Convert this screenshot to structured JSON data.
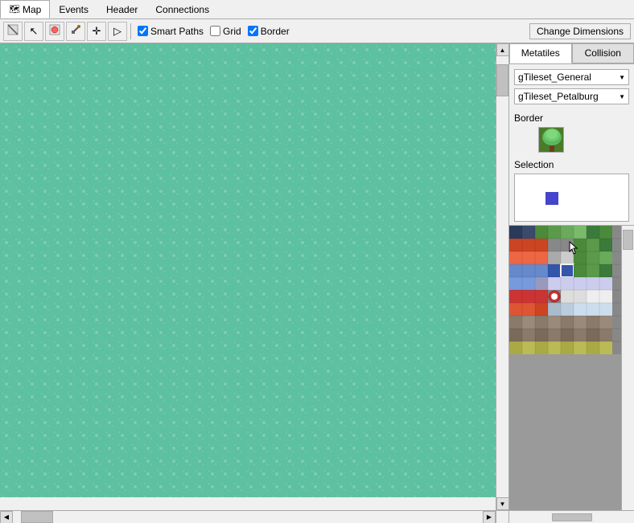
{
  "menu": {
    "tabs": [
      {
        "id": "map",
        "label": "Map",
        "active": true,
        "icon": "🗺"
      },
      {
        "id": "events",
        "label": "Events",
        "active": false
      },
      {
        "id": "header",
        "label": "Header",
        "active": false
      },
      {
        "id": "connections",
        "label": "Connections",
        "active": false
      }
    ]
  },
  "toolbar": {
    "tools": [
      {
        "id": "pencil",
        "icon": "✏",
        "active": false,
        "label": "Draw"
      },
      {
        "id": "select",
        "icon": "↖",
        "active": false,
        "label": "Select"
      },
      {
        "id": "fill",
        "icon": "⊕",
        "active": false,
        "label": "Fill"
      },
      {
        "id": "eyedropper",
        "icon": "⊘",
        "active": false,
        "label": "Eyedropper"
      },
      {
        "id": "move",
        "icon": "✛",
        "active": false,
        "label": "Move"
      },
      {
        "id": "forward",
        "icon": "▷",
        "active": false,
        "label": "Forward"
      }
    ],
    "checkboxes": [
      {
        "id": "smart-paths",
        "label": "Smart Paths",
        "checked": true
      },
      {
        "id": "grid",
        "label": "Grid",
        "checked": false
      },
      {
        "id": "border",
        "label": "Border",
        "checked": true
      }
    ],
    "change_dimensions_label": "Change Dimensions"
  },
  "right_panel": {
    "tabs": [
      {
        "id": "metatiles",
        "label": "Metatiles",
        "active": true
      },
      {
        "id": "collision",
        "label": "Collision",
        "active": false
      }
    ],
    "tileset1": {
      "label": "gTileset_General",
      "value": "gTileset_General"
    },
    "tileset2": {
      "label": "gTileset_Petalburg",
      "value": "gTileset_Petalburg"
    },
    "border_label": "Border",
    "selection_label": "Selection"
  },
  "scrollbars": {
    "up_arrow": "▲",
    "down_arrow": "▼",
    "left_arrow": "◀",
    "right_arrow": "▶"
  }
}
